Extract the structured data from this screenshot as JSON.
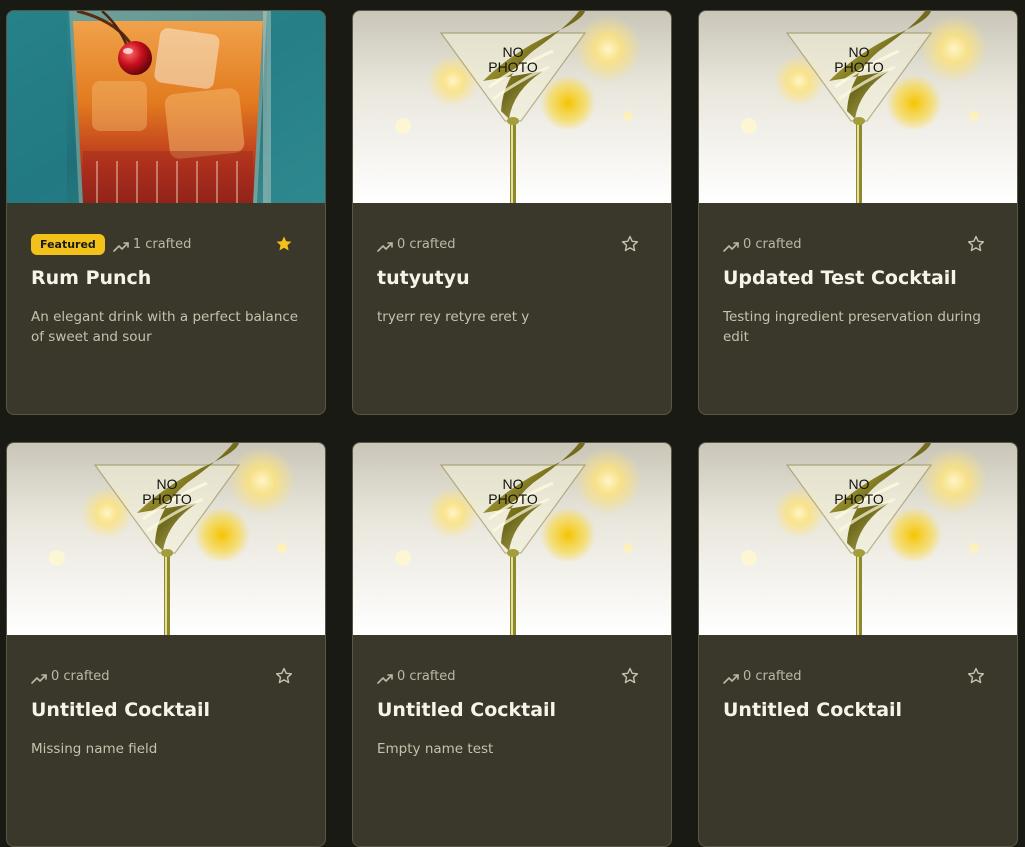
{
  "cards": [
    {
      "featured": true,
      "badge": "Featured",
      "crafted": "1 crafted",
      "starred": true,
      "title": "Rum Punch",
      "desc": "An elegant drink with a perfect balance of sweet and sour",
      "photo": "rum-punch",
      "nophoto_line1": "",
      "nophoto_line2": ""
    },
    {
      "featured": false,
      "badge": "",
      "crafted": "0 crafted",
      "starred": false,
      "title": "tutyutyu",
      "desc": "tryerr rey retyre eret y",
      "photo": "placeholder",
      "nophoto_line1": "NO",
      "nophoto_line2": "PHOTO"
    },
    {
      "featured": false,
      "badge": "",
      "crafted": "0 crafted",
      "starred": false,
      "title": "Updated Test Cocktail",
      "desc": "Testing ingredient preservation during edit",
      "photo": "placeholder",
      "nophoto_line1": "NO",
      "nophoto_line2": "PHOTO"
    },
    {
      "featured": false,
      "badge": "",
      "crafted": "0 crafted",
      "starred": false,
      "title": "Untitled Cocktail",
      "desc": "Missing name field",
      "photo": "placeholder",
      "nophoto_line1": "NO",
      "nophoto_line2": "PHOTO"
    },
    {
      "featured": false,
      "badge": "",
      "crafted": "0 crafted",
      "starred": false,
      "title": "Untitled Cocktail",
      "desc": "Empty name test",
      "photo": "placeholder",
      "nophoto_line1": "NO",
      "nophoto_line2": "PHOTO"
    },
    {
      "featured": false,
      "badge": "",
      "crafted": "0 crafted",
      "starred": false,
      "title": "Untitled Cocktail",
      "desc": "",
      "photo": "placeholder",
      "nophoto_line1": "NO",
      "nophoto_line2": "PHOTO"
    }
  ],
  "colors": {
    "background": "#1a1a14",
    "card": "#3a372b",
    "accent": "#f2c21a",
    "text": "#f6f3ea",
    "muted": "#c7c2ae"
  },
  "icons": {
    "crafted": "trending-up-icon",
    "favorite": "star-icon"
  }
}
